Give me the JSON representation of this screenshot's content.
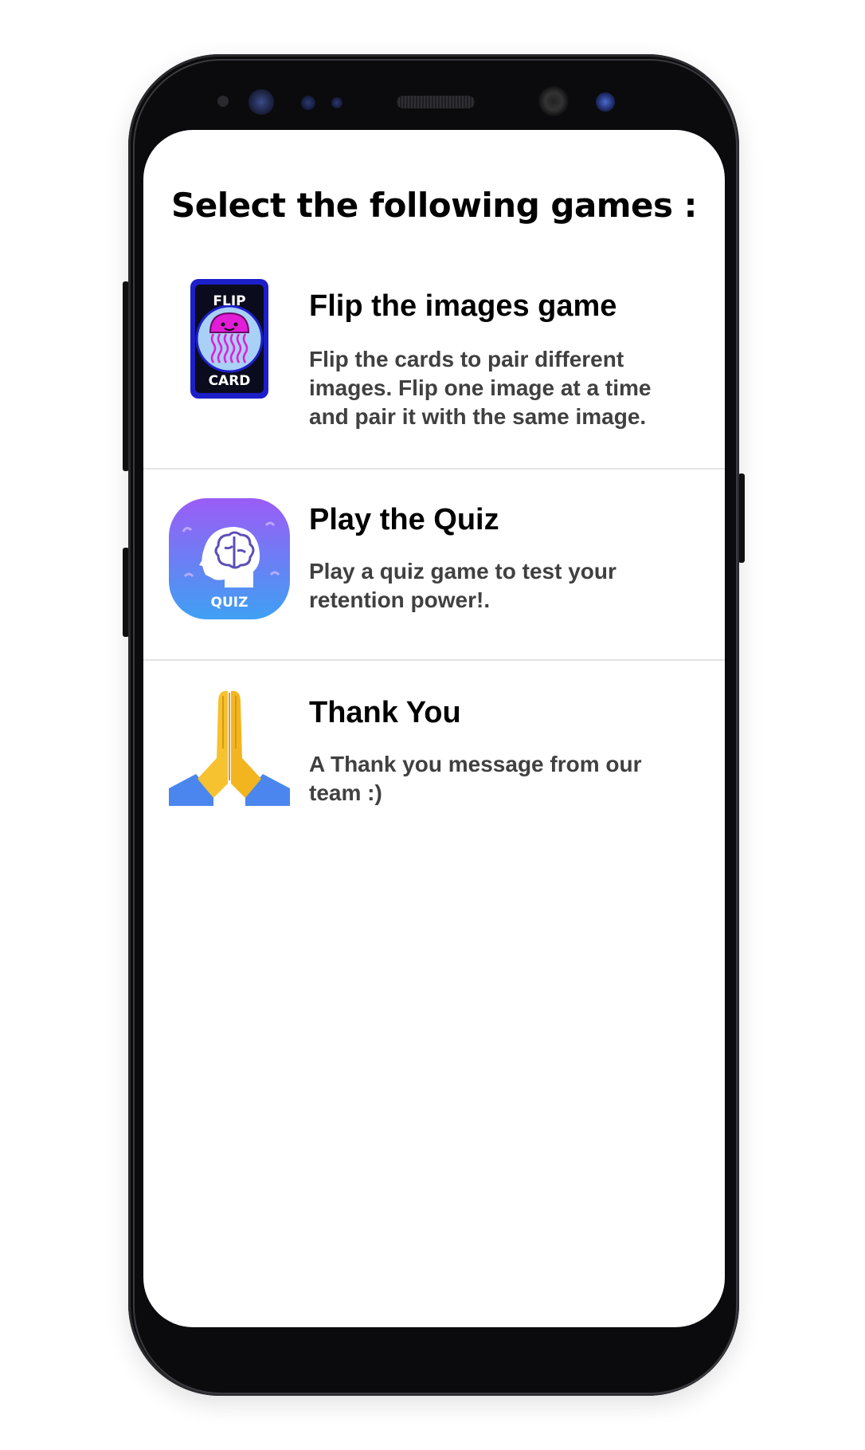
{
  "header": {
    "title": "Select the following games :"
  },
  "games": [
    {
      "title": "Flip the images game",
      "description": "Flip the cards to pair different images. Flip one image at a time and pair it with the same image.",
      "icon": "flip-card-icon",
      "icon_text_top": "FLIP",
      "icon_text_bottom": "CARD"
    },
    {
      "title": "Play the Quiz",
      "description": "Play a quiz game to test your retention power!.",
      "icon": "quiz-brain-icon",
      "icon_text": "QUIZ"
    },
    {
      "title": "Thank You",
      "description": "A Thank you message from our team :)",
      "icon": "praying-hands-icon"
    }
  ],
  "colors": {
    "divider": "#e4e4e4",
    "title_text": "#000000",
    "desc_text": "#404040",
    "quiz_gradient_top": "#9b5cf6",
    "quiz_gradient_bottom": "#3fa0f3",
    "flip_card_frame": "#1d1fc9",
    "jellyfish": "#e21dd8"
  }
}
